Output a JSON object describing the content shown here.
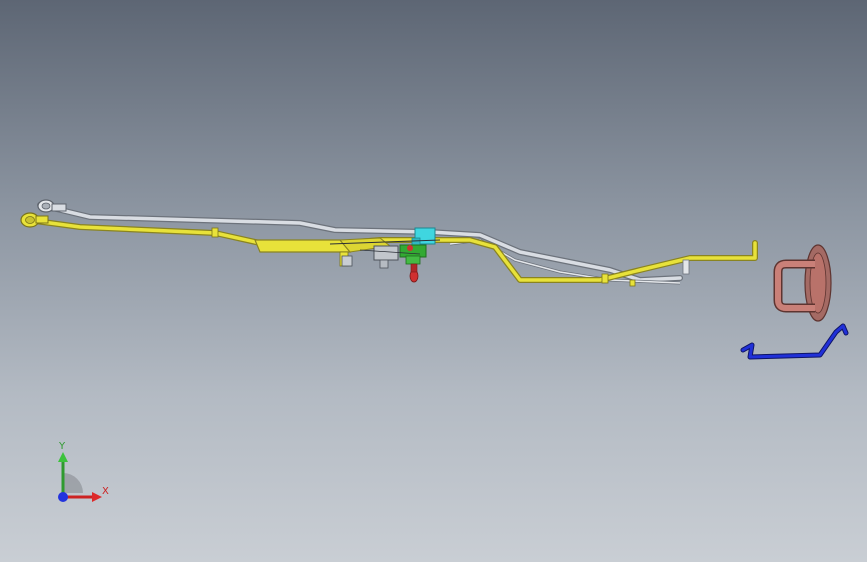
{
  "viewport": {
    "background_top": "#5d6674",
    "background_bottom": "#c9ced4"
  },
  "colors": {
    "yellow_tube": "#e8e23a",
    "yellow_edge": "#8a8420",
    "silver_tube": "#d9dde3",
    "silver_edge": "#6d737c",
    "blue_part": "#2030d8",
    "copper_part": "#b9726a",
    "cyan_block": "#3fd6e0",
    "red_part": "#d03030",
    "green_part": "#33aa33"
  },
  "triad": {
    "x_label": "X",
    "y_label": "Y",
    "x_color": "#cc2222",
    "y_color": "#2f9a2f",
    "z_color": "#2233dd"
  }
}
